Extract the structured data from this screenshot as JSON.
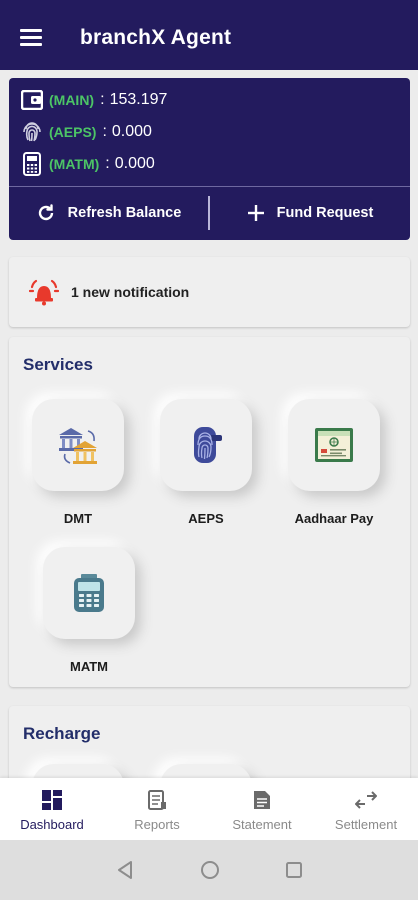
{
  "app": {
    "title": "branchX Agent"
  },
  "wallet": {
    "rows": [
      {
        "label": "(MAIN)",
        "separator": ":",
        "value": "153.197",
        "icon": "wallet-icon"
      },
      {
        "label": "(AEPS)",
        "separator": ":",
        "value": "0.000",
        "icon": "fingerprint-icon"
      },
      {
        "label": "(MATM)",
        "separator": ":",
        "value": "0.000",
        "icon": "pos-terminal-icon"
      }
    ],
    "refresh_label": "Refresh Balance",
    "fund_label": "Fund Request"
  },
  "notification": {
    "text": "1 new notification",
    "icon": "alarm-bell-icon"
  },
  "services": {
    "title": "Services",
    "items": [
      {
        "label": "DMT",
        "icon": "bank-transfer-icon"
      },
      {
        "label": "AEPS",
        "icon": "fingerprint-scanner-icon"
      },
      {
        "label": "Aadhaar Pay",
        "icon": "aadhaar-card-icon"
      },
      {
        "label": "MATM",
        "icon": "micro-atm-icon"
      }
    ]
  },
  "recharge": {
    "title": "Recharge"
  },
  "bottom_nav": {
    "items": [
      {
        "label": "Dashboard",
        "icon": "dashboard-icon",
        "active": true
      },
      {
        "label": "Reports",
        "icon": "reports-icon",
        "active": false
      },
      {
        "label": "Statement",
        "icon": "statement-icon",
        "active": false
      },
      {
        "label": "Settlement",
        "icon": "settlement-icon",
        "active": false
      }
    ]
  },
  "colors": {
    "primary": "#231b5e",
    "wallet_label": "#4cc466",
    "section_title": "#232e6a",
    "alert": "#e8392c"
  }
}
